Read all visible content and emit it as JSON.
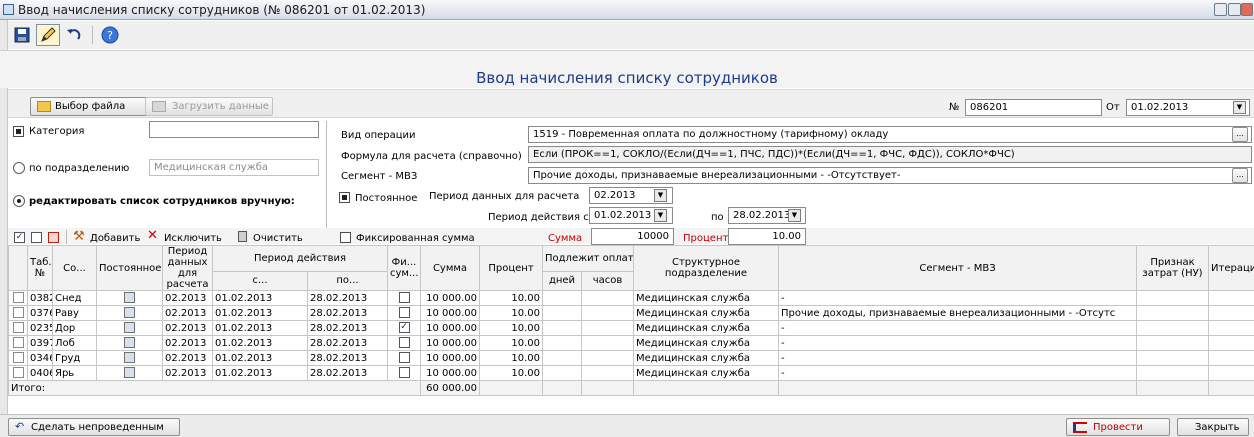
{
  "window": {
    "title": "Ввод начисления списку сотрудников (№ 086201 от 01.02.2013)"
  },
  "heading": "Ввод начисления списку сотрудников",
  "actions": {
    "choose_file": "Выбор файла",
    "load_data": "Загрузить данные"
  },
  "doc": {
    "number_label": "№",
    "number": "086201",
    "date_label": "От",
    "date": "01.02.2013"
  },
  "left": {
    "category_label": "Категория",
    "category_value": "",
    "by_department_label": "по подразделению",
    "department_value": "Медицинская служба",
    "manual_label": "редактировать список сотрудников вручную:"
  },
  "form": {
    "op_label": "Вид операции",
    "op_value": "1519 - Повременная оплата по должностному (тарифному) окладу",
    "formula_label": "Формула для расчета (справочно)",
    "formula_value": "Если (ПРОК==1, СОКЛО/(Если(ДЧ==1, ПЧС, ПДС))*(Если(ДЧ==1, ФЧС, ФДС)), СОКЛО*ФЧС)",
    "segment_label": "Сегмент - МВЗ",
    "segment_value": "Прочие доходы, признаваемые внереализационными - -Отсутствует-",
    "permanent_label": "Постоянное",
    "data_period_label": "Период данных для расчета",
    "data_period_value": "02.2013",
    "action_from_label": "Период действия с",
    "action_from_value": "01.02.2013",
    "action_to_label": "по",
    "action_to_value": "28.02.2013",
    "fixed_label": "Фиксированная сумма",
    "sum_label": "Сумма",
    "sum_value": "10000",
    "percent_label": "Процент",
    "percent_value": "10.00"
  },
  "listbar": {
    "add": "Добавить",
    "exclude": "Исключить",
    "clear": "Очистить"
  },
  "grid": {
    "headers": {
      "tab": "Таб. №",
      "co": "Со...",
      "permanent": "Постоянное",
      "data_period": "Период данных для расчета",
      "action_period": "Период действия",
      "from": "с...",
      "to": "по...",
      "fixed": "Фи... сум...",
      "sum": "Сумма",
      "percent": "Процент",
      "payable": "Подлежит оплате",
      "days": "дней",
      "hours": "часов",
      "dept": "Структурное подразделение",
      "segment": "Сегмент - МВЗ",
      "cost": "Признак затрат (НУ)",
      "iter": "Итерация"
    },
    "rows": [
      {
        "tab": "0382",
        "co": "Снед",
        "data_period": "02.2013",
        "from": "01.02.2013",
        "to": "28.02.2013",
        "fixed": false,
        "sum": "10 000.00",
        "percent": "10.00",
        "dept": "Медицинская служба",
        "segment": "-"
      },
      {
        "tab": "0376",
        "co": "Раву",
        "data_period": "02.2013",
        "from": "01.02.2013",
        "to": "28.02.2013",
        "fixed": false,
        "sum": "10 000.00",
        "percent": "10.00",
        "dept": "Медицинская служба",
        "segment": "Прочие доходы, признаваемые внереализационными - -Отсутс"
      },
      {
        "tab": "0235",
        "co": "Дор",
        "data_period": "02.2013",
        "from": "01.02.2013",
        "to": "28.02.2013",
        "fixed": true,
        "sum": "10 000.00",
        "percent": "10.00",
        "dept": "Медицинская служба",
        "segment": "-"
      },
      {
        "tab": "0397",
        "co": "Лоб",
        "data_period": "02.2013",
        "from": "01.02.2013",
        "to": "28.02.2013",
        "fixed": false,
        "sum": "10 000.00",
        "percent": "10.00",
        "dept": "Медицинская служба",
        "segment": "-"
      },
      {
        "tab": "0346",
        "co": "Груд",
        "data_period": "02.2013",
        "from": "01.02.2013",
        "to": "28.02.2013",
        "fixed": false,
        "sum": "10 000.00",
        "percent": "10.00",
        "dept": "Медицинская служба",
        "segment": "-"
      },
      {
        "tab": "0406",
        "co": "Ярь",
        "data_period": "02.2013",
        "from": "01.02.2013",
        "to": "28.02.2013",
        "fixed": false,
        "sum": "10 000.00",
        "percent": "10.00",
        "dept": "Медицинская служба",
        "segment": "-"
      }
    ],
    "total_label": "Итого:",
    "total_sum": "60 000.00"
  },
  "footer": {
    "unpost": "Сделать непроведенным",
    "post": "Провести",
    "close": "Закрыть"
  },
  "colors": {
    "accent": "#1f3a8a",
    "post_text": "#c00000"
  }
}
